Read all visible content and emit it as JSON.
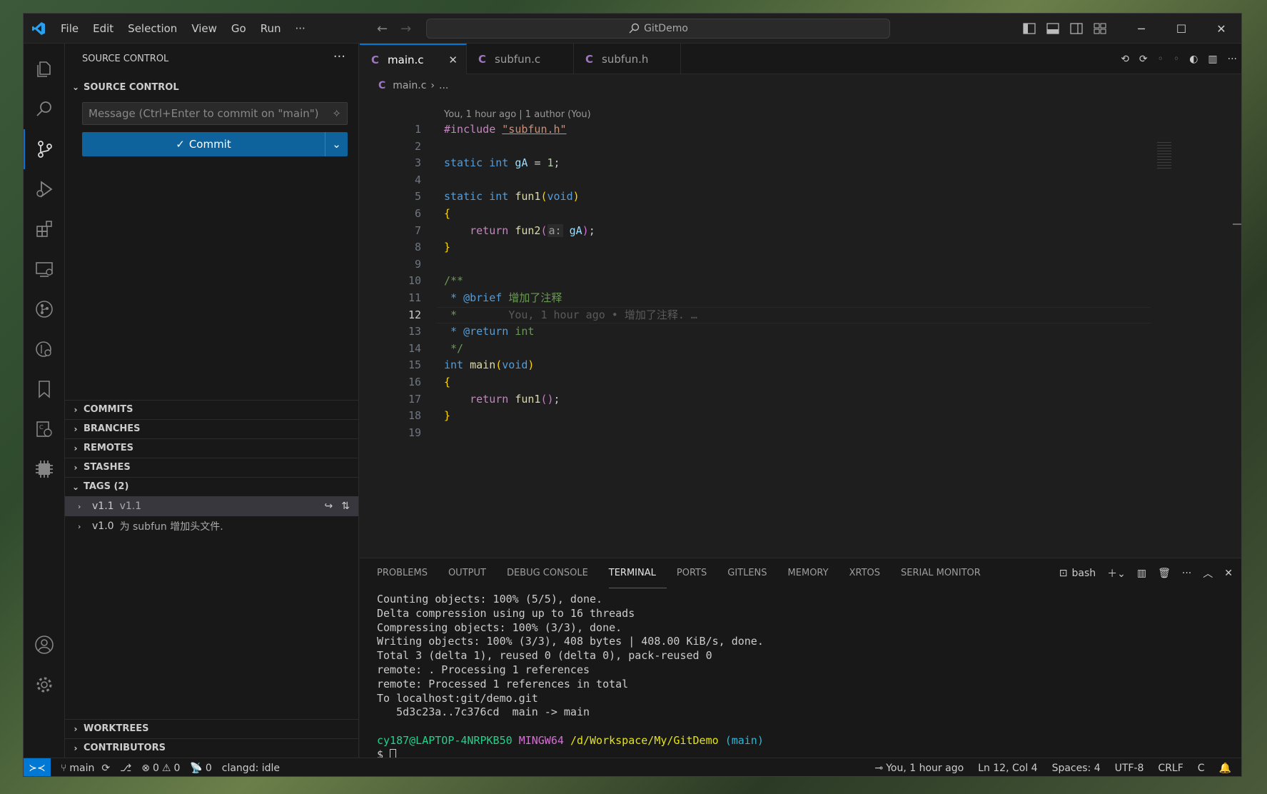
{
  "titlebar": {
    "menu": [
      "File",
      "Edit",
      "Selection",
      "View",
      "Go",
      "Run",
      "···"
    ],
    "search": "GitDemo"
  },
  "sidebar": {
    "title": "SOURCE CONTROL",
    "section": "SOURCE CONTROL",
    "commit_placeholder": "Message (Ctrl+Enter to commit on \"main\")",
    "commit_label": "Commit",
    "sections": [
      "COMMITS",
      "BRANCHES",
      "REMOTES",
      "STASHES"
    ],
    "tags_header": "TAGS (2)",
    "tags": [
      {
        "name": "v1.1",
        "desc": "v1.1"
      },
      {
        "name": "v1.0",
        "desc": "为 subfun 增加头文件."
      }
    ],
    "bottom_sections": [
      "WORKTREES",
      "CONTRIBUTORS"
    ]
  },
  "editor": {
    "tabs": [
      {
        "label": "main.c",
        "active": true
      },
      {
        "label": "subfun.c",
        "active": false
      },
      {
        "label": "subfun.h",
        "active": false
      }
    ],
    "tab_icon_letter": "C",
    "breadcrumb_file": "main.c",
    "breadcrumb_more": "...",
    "codelens": "You, 1 hour ago | 1 author (You)",
    "line_numbers": [
      "1",
      "2",
      "3",
      "4",
      "5",
      "6",
      "7",
      "8",
      "9",
      "10",
      "11",
      "12",
      "13",
      "14",
      "15",
      "16",
      "17",
      "18",
      "19"
    ],
    "code": {
      "l1_pp": "#include",
      "l1_str": "\"subfun.h\"",
      "l3_kw": "static int",
      "l3_var": "gA",
      "l3_eq": "=",
      "l3_num": "1",
      "l5_kw": "static int",
      "l5_fn": "fun1",
      "l5_param": "void",
      "l7_kw": "return",
      "l7_fn": "fun2",
      "l7_hint": "a:",
      "l7_arg": "gA",
      "l10": "/**",
      "l11_tag": " * @brief",
      "l11_text": "增加了注释",
      "l12": " *",
      "l12_blame": "You, 1 hour ago • 增加了注释. …",
      "l13_tag": " * @return",
      "l13_text": "int",
      "l14": " */",
      "l15_kw": "int",
      "l15_fn": "main",
      "l15_param": "void",
      "l17_kw": "return",
      "l17_fn": "fun1"
    }
  },
  "panel": {
    "tabs": [
      "PROBLEMS",
      "OUTPUT",
      "DEBUG CONSOLE",
      "TERMINAL",
      "PORTS",
      "GITLENS",
      "MEMORY",
      "XRTOS",
      "SERIAL MONITOR"
    ],
    "active_tab": "TERMINAL",
    "shell": "bash",
    "terminal_lines": [
      "Counting objects: 100% (5/5), done.",
      "Delta compression using up to 16 threads",
      "Compressing objects: 100% (3/3), done.",
      "Writing objects: 100% (3/3), 408 bytes | 408.00 KiB/s, done.",
      "Total 3 (delta 1), reused 0 (delta 0), pack-reused 0",
      "remote: . Processing 1 references",
      "remote: Processed 1 references in total",
      "To localhost:git/demo.git",
      "   5d3c23a..7c376cd  main -> main"
    ],
    "prompt": {
      "user": "cy187@LAPTOP-4NRPKB50",
      "env": "MINGW64",
      "path": "/d/Workspace/My/GitDemo",
      "branch": "(main)",
      "symbol": "$"
    }
  },
  "statusbar": {
    "branch": "main",
    "errors": "0",
    "warnings": "0",
    "ports": "0",
    "clangd": "clangd: idle",
    "blame": "You, 1 hour ago",
    "position": "Ln 12, Col 4",
    "spaces": "Spaces: 4",
    "encoding": "UTF-8",
    "eol": "CRLF",
    "language": "C"
  }
}
